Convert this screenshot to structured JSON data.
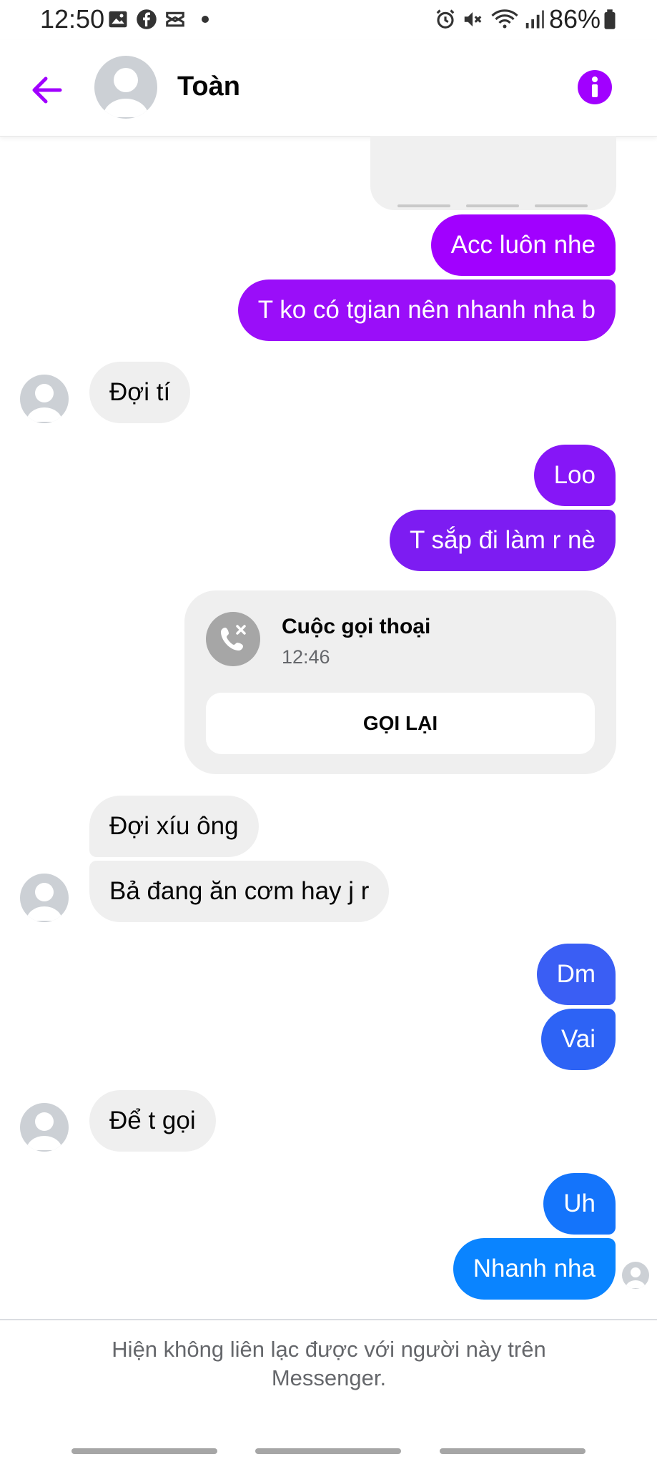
{
  "status_bar": {
    "time": "12:50",
    "notification_icons": [
      "image-icon",
      "facebook-icon",
      "capcut-icon",
      "dot-icon"
    ],
    "system_icons": [
      "alarm-icon",
      "mute-icon",
      "wifi-icon",
      "signal-icon",
      "battery-icon"
    ],
    "battery": "86%"
  },
  "header": {
    "contact_name": "Toàn",
    "back_icon": "arrow-left-icon",
    "info_icon": "info-icon",
    "accent_color": "#a100ff"
  },
  "messages": [
    {
      "from": "me",
      "text": "Acc luôn nhe"
    },
    {
      "from": "me",
      "text": "T ko có tgian nên nhanh nha b"
    },
    {
      "from": "them",
      "text": "Đợi tí"
    },
    {
      "from": "me",
      "text": "Loo"
    },
    {
      "from": "me",
      "text": "T sắp đi làm r nè"
    },
    {
      "from": "them",
      "text": "Đợi xíu ông"
    },
    {
      "from": "them",
      "text": "Bả đang ăn cơm hay j r"
    },
    {
      "from": "me",
      "text": "Dm"
    },
    {
      "from": "me",
      "text": "Vai"
    },
    {
      "from": "them",
      "text": "Để t gọi"
    },
    {
      "from": "me",
      "text": "Uh"
    },
    {
      "from": "me",
      "text": "Nhanh nha"
    }
  ],
  "call_card": {
    "title": "Cuộc gọi thoại",
    "time": "12:46",
    "button_label": "GỌI LẠI",
    "icon": "missed-call-icon"
  },
  "footer": {
    "notice": "Hiện không liên lạc được với người này trên Messenger."
  },
  "colors": {
    "purple": "#a100ff",
    "violet": "#7d1cf2",
    "indigo": "#5d2cf0",
    "blue": "#2d63f5",
    "light_blue": "#0a84ff",
    "incoming_bg": "#efefef"
  }
}
